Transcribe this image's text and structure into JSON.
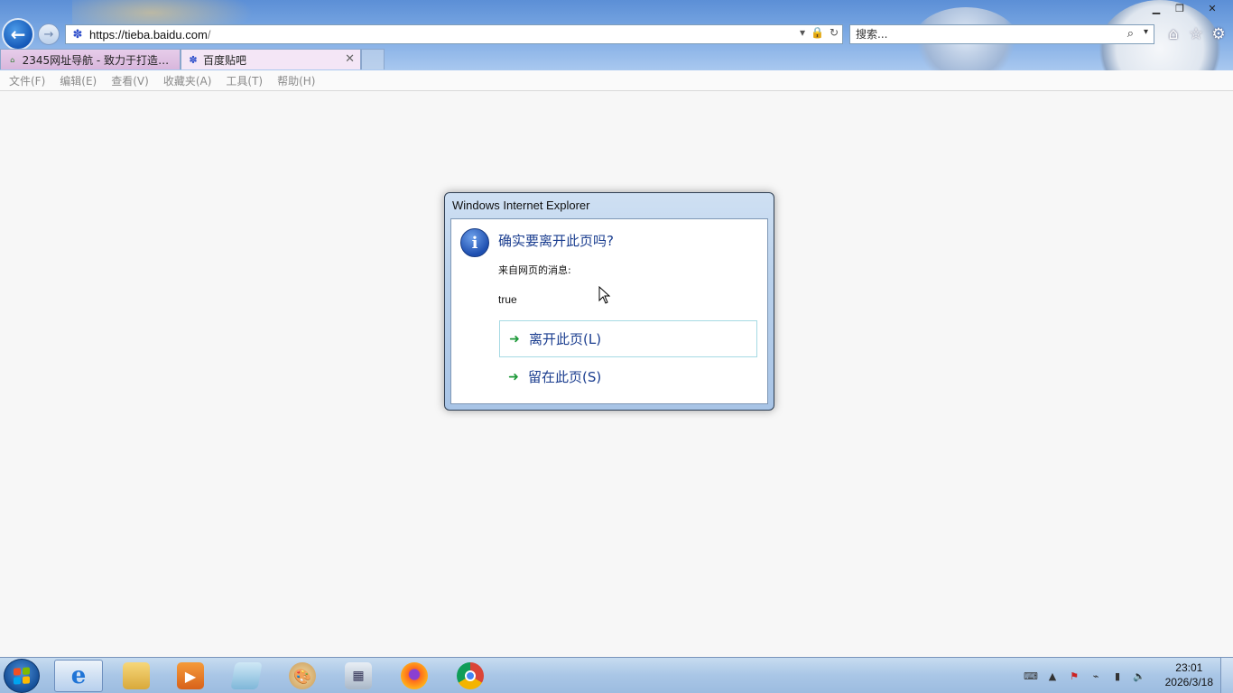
{
  "browser": {
    "url_prefix": "https://tieba.",
    "url_domain": "baidu.com",
    "url_suffix": "/",
    "search_placeholder": "搜索...",
    "tabs": [
      {
        "label": "2345网址导航 - 致力于打造百...",
        "favicon": "2345"
      },
      {
        "label": "百度贴吧",
        "favicon": "paw"
      }
    ],
    "menu": [
      "文件(F)",
      "编辑(E)",
      "查看(V)",
      "收藏夹(A)",
      "工具(T)",
      "帮助(H)"
    ]
  },
  "dialog": {
    "title": "Windows Internet Explorer",
    "heading": "确实要离开此页吗?",
    "source": "来自网页的消息:",
    "message": "true",
    "leave_label": "离开此页(L)",
    "stay_label": "留在此页(S)"
  },
  "taskbar": {
    "apps": [
      "internet-explorer",
      "file-explorer",
      "media-player",
      "notepad",
      "paint",
      "calculator",
      "firefox",
      "chrome"
    ],
    "time": "23:01",
    "date": "2026/3/18"
  }
}
